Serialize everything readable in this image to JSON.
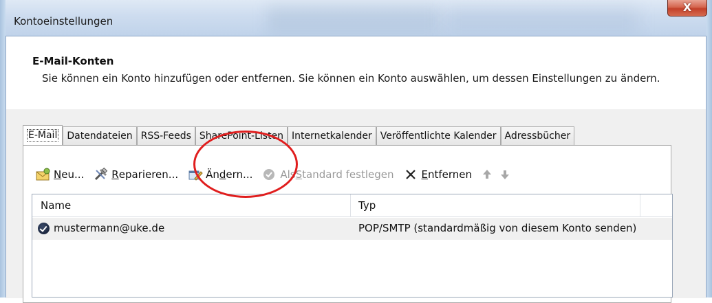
{
  "window": {
    "title": "Kontoeinstellungen",
    "close_label": "X"
  },
  "header": {
    "title": "E-Mail-Konten",
    "description": "Sie können ein Konto hinzufügen oder entfernen. Sie können ein Konto auswählen, um dessen Einstellungen zu ändern."
  },
  "tabs": [
    {
      "label": "E-Mail",
      "active": true
    },
    {
      "label": "Datendateien"
    },
    {
      "label": "RSS-Feeds"
    },
    {
      "label": "SharePoint-Listen"
    },
    {
      "label": "Internetkalender"
    },
    {
      "label": "Veröffentlichte Kalender"
    },
    {
      "label": "Adressbücher"
    }
  ],
  "toolbar": {
    "new_pre": "",
    "new_u": "N",
    "new_post": "eu...",
    "repair_pre": "",
    "repair_u": "R",
    "repair_post": "eparieren...",
    "change_pre": "Än",
    "change_u": "d",
    "change_post": "ern...",
    "default_pre": "Als ",
    "default_u": "S",
    "default_post": "tandard festlegen",
    "remove_pre": "",
    "remove_u": "E",
    "remove_post": "ntfernen"
  },
  "list": {
    "columns": {
      "name": "Name",
      "type": "Typ"
    },
    "rows": [
      {
        "name": "mustermann@uke.de",
        "type": "POP/SMTP (standardmäßig von diesem Konto senden)"
      }
    ]
  },
  "colors": {
    "annotation_circle": "#e01e1e",
    "close_button": "#c2412a"
  }
}
